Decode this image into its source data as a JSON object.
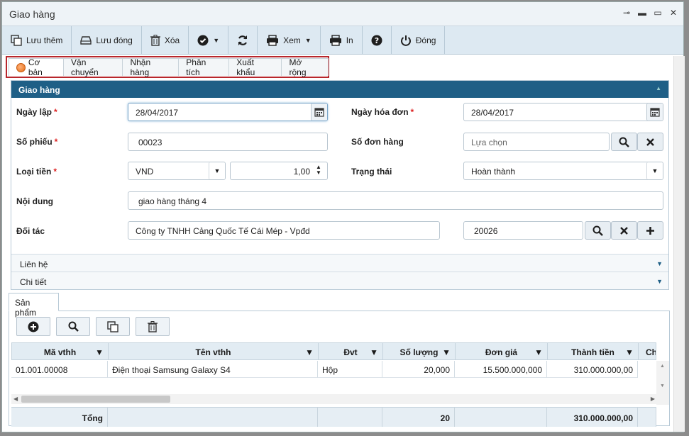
{
  "window": {
    "title": "Giao hàng"
  },
  "toolbar": {
    "luu_them": "Lưu thêm",
    "luu_dong": "Lưu đóng",
    "xoa": "Xóa",
    "xem": "Xem",
    "in": "In",
    "dong": "Đóng"
  },
  "tabs": [
    "Cơ bản",
    "Vận chuyển",
    "Nhận hàng",
    "Phân tích",
    "Xuất khẩu",
    "Mở rộng"
  ],
  "section": {
    "title": "Giao hàng"
  },
  "form": {
    "ngay_lap_label": "Ngày lập",
    "ngay_lap": "28/04/2017",
    "ngay_hoa_don_label": "Ngày hóa đơn",
    "ngay_hoa_don": "28/04/2017",
    "so_phieu_label": "Số phiếu",
    "so_phieu": "00023",
    "so_don_hang_label": "Số đơn hàng",
    "so_don_hang_placeholder": "Lựa chọn",
    "loai_tien_label": "Loại tiền",
    "loai_tien": "VND",
    "ty_gia": "1,00",
    "trang_thai_label": "Trạng thái",
    "trang_thai": "Hoàn thành",
    "noi_dung_label": "Nội dung",
    "noi_dung": "giao hàng tháng 4",
    "doi_tac_label": "Đối tác",
    "doi_tac": "Công ty TNHH Cảng Quốc Tế Cái Mép - Vpđd",
    "doi_tac_code": "20026"
  },
  "accordions": {
    "lien_he": "Liên hệ",
    "chi_tiet": "Chi tiết"
  },
  "products_tab": "Sản phẩm",
  "grid": {
    "columns": [
      "Mã vthh",
      "Tên vthh",
      "Đvt",
      "Số lượng",
      "Đơn giá",
      "Thành tiền",
      "Ch"
    ],
    "rows": [
      [
        "01.001.00008",
        "Điện thoại Samsung Galaxy S4",
        "Hộp",
        "20,000",
        "15.500.000,000",
        "310.000.000,00"
      ]
    ],
    "footer": {
      "label": "Tổng",
      "so_luong": "20",
      "thanh_tien": "310.000.000,00"
    }
  },
  "colors": {
    "header": "#1f5f86",
    "toolbar": "#dde9f2",
    "highlight": "#b8262c",
    "active_tab_dot": "#e56b12"
  }
}
